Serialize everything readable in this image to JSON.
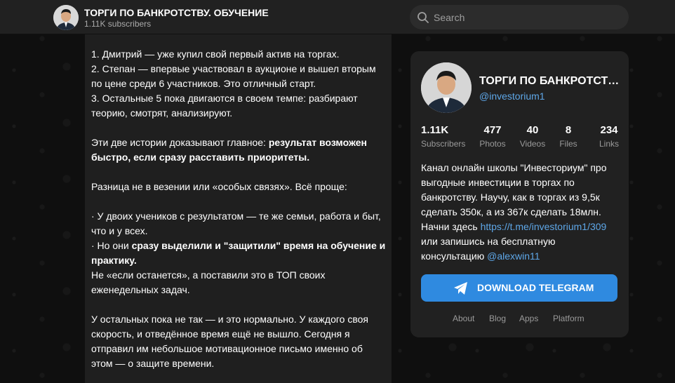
{
  "header": {
    "channel_title": "ТОРГИ ПО БАНКРОТСТВУ. ОБУЧЕНИЕ",
    "subscribers": "1.11K subscribers"
  },
  "search": {
    "placeholder": "Search"
  },
  "post": {
    "lines": [
      "1. Дмитрий — уже купил свой первый актив на торгах.",
      "2. Степан — впервые участвовал в аукционе и вышел вторым",
      "по цене среди 6 участников. Это отличный старт.",
      "3. Остальные 5 пока двигаются в своем темпе: разбирают",
      "теорию, смотрят, анализируют.",
      "Эти две истории доказывают главное: ",
      "результат возможен",
      "быстро, если сразу расставить приоритеты.",
      "Разница не в везении или «особых связях». Всё проще:",
      "· У двоих учеников с результатом — те же семьи, работа и быт,",
      "что и у всех.",
      "· Но они ",
      "сразу выделили и \"защитили\" время на обучение и",
      "практику.",
      "Не «если останется», а поставили это в ТОП своих",
      "еженедельных задач.",
      "У остальных пока не так — и это нормально. У каждого своя",
      "скорость, и отведённое время ещё не вышло. Сегодня я",
      "отправил им небольшое мотивационное письмо именно об",
      "этом — о защите времени."
    ]
  },
  "card": {
    "name": "ТОРГИ ПО БАНКРОТСТВ...",
    "handle": "@investorium1",
    "stats": [
      {
        "value": "1.11K",
        "label": "Subscribers"
      },
      {
        "value": "477",
        "label": "Photos"
      },
      {
        "value": "40",
        "label": "Videos"
      },
      {
        "value": "8",
        "label": "Files"
      },
      {
        "value": "234",
        "label": "Links"
      }
    ],
    "description": {
      "line1": "Канал онлайн школы \"Инвесториум\" про",
      "line2": "выгодные инвестиции в торгах по",
      "line3": "банкротству. Научу, как в торгах из 9,5к",
      "line4": "сделать 350к, а из 367к сделать 18млн.",
      "line5_prefix": "Начни здесь ",
      "link1": "https://t.me/investorium1/309",
      "line6": "или запишись на бесплатную",
      "line7_prefix": "консультацию ",
      "link2": "@alexwin11"
    },
    "download_label": "DOWNLOAD TELEGRAM",
    "footer": [
      "About",
      "Blog",
      "Apps",
      "Platform"
    ]
  },
  "colors": {
    "accent": "#2f8ae0",
    "link": "#5ea7e8",
    "panel": "#212121",
    "background": "#0f0f0f"
  },
  "icons": {
    "search": "search-icon",
    "download": "telegram-plane-icon"
  }
}
